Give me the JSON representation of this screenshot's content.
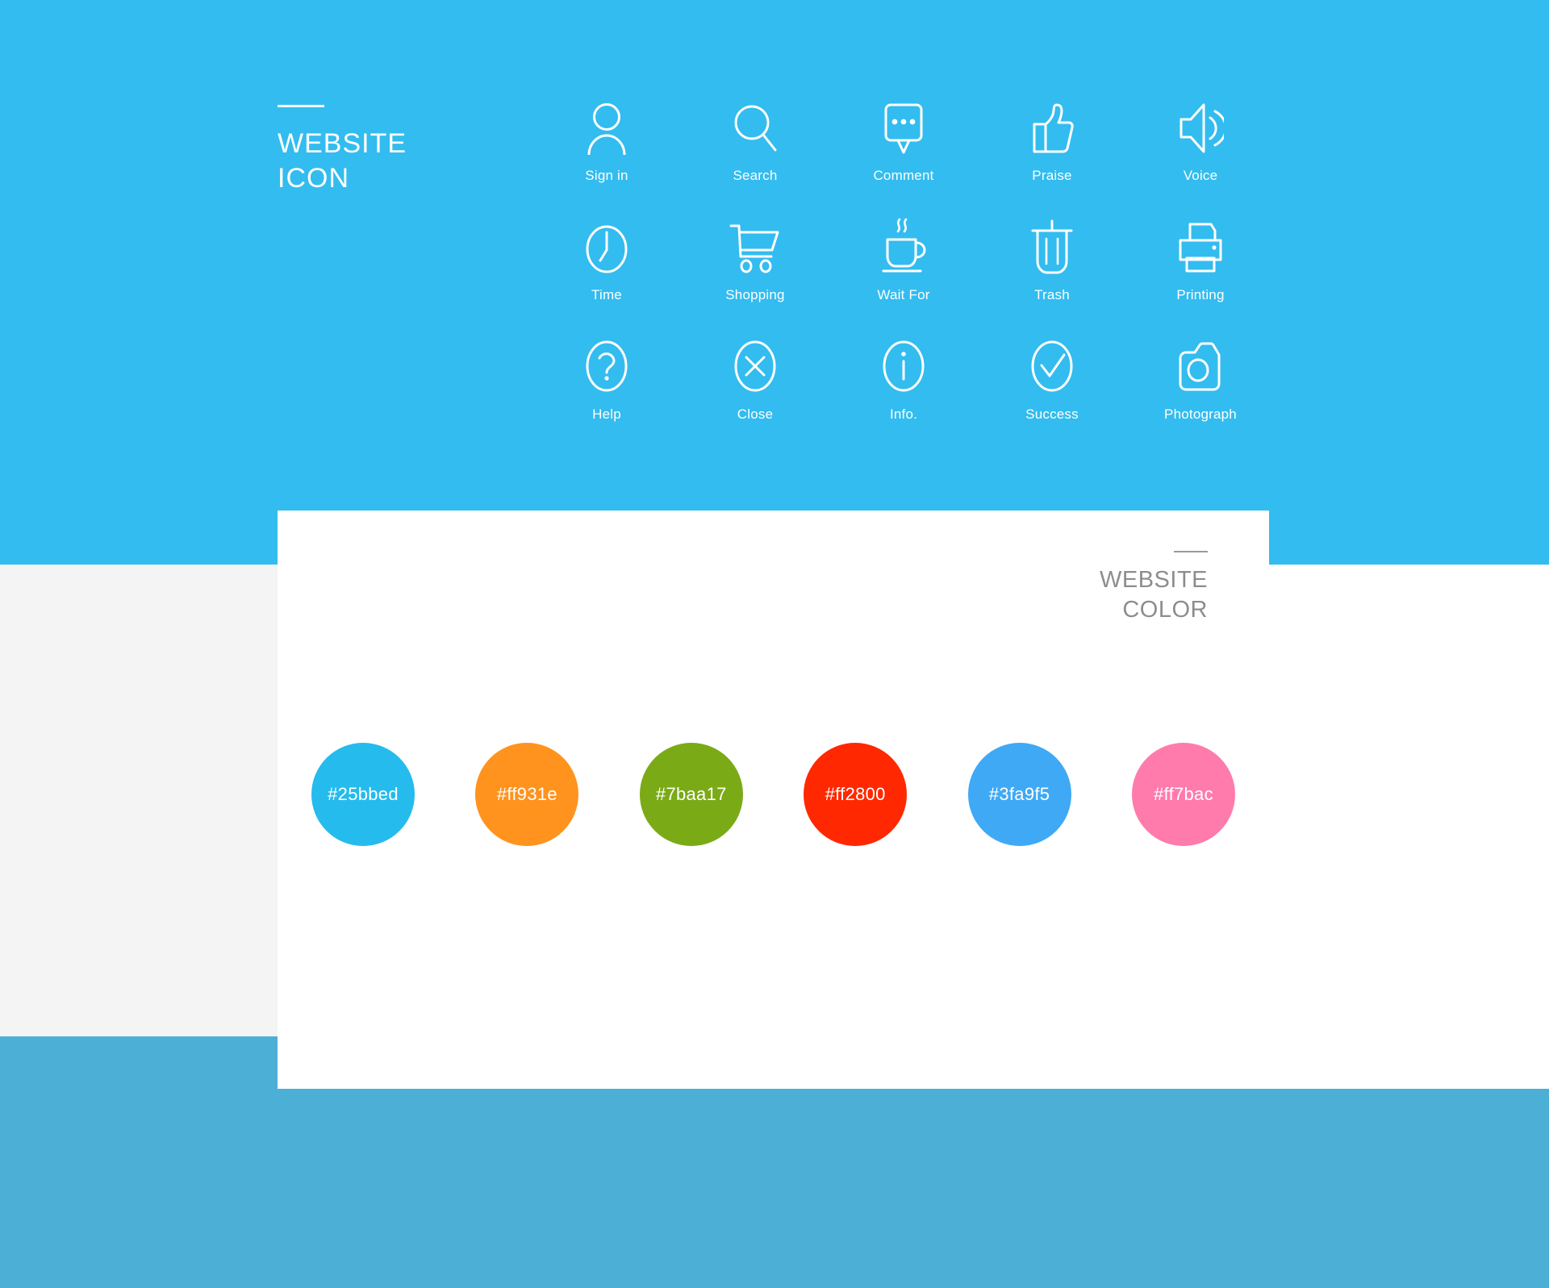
{
  "page": {
    "background_colors": {
      "header_blue": "#33bcef",
      "gray_band": "#f4f4f4",
      "footer_blue": "#4cb0d6",
      "card_white": "#ffffff"
    }
  },
  "header": {
    "title_line_1": "WEBSITE",
    "title_line_2": "ICON",
    "text_color": "#ffffff"
  },
  "icons": {
    "rows": [
      [
        {
          "label": "Sign in",
          "icon": "person-icon"
        },
        {
          "label": "Search",
          "icon": "magnifier-icon"
        },
        {
          "label": "Comment",
          "icon": "speech-bubble-icon"
        },
        {
          "label": "Praise",
          "icon": "thumbs-up-icon"
        },
        {
          "label": "Voice",
          "icon": "speaker-icon"
        }
      ],
      [
        {
          "label": "Time",
          "icon": "clock-icon"
        },
        {
          "label": "Shopping",
          "icon": "shopping-cart-icon"
        },
        {
          "label": "Wait For",
          "icon": "coffee-cup-icon"
        },
        {
          "label": "Trash",
          "icon": "trash-bin-icon"
        },
        {
          "label": "Printing",
          "icon": "printer-icon"
        }
      ],
      [
        {
          "label": "Help",
          "icon": "question-mark-circle-icon"
        },
        {
          "label": "Close",
          "icon": "x-circle-icon"
        },
        {
          "label": "Info.",
          "icon": "info-circle-icon"
        },
        {
          "label": "Success",
          "icon": "check-circle-icon"
        },
        {
          "label": "Photograph",
          "icon": "camera-icon"
        }
      ]
    ]
  },
  "color_card": {
    "title_line_1": "WEBSITE",
    "title_line_2": "COLOR",
    "title_color": "#8d8d8d",
    "swatches": [
      {
        "hex": "#25bbed",
        "label": "#25bbed"
      },
      {
        "hex": "#ff931e",
        "label": "#ff931e"
      },
      {
        "hex": "#7baa17",
        "label": "#7baa17"
      },
      {
        "hex": "#ff2800",
        "label": "#ff2800"
      },
      {
        "hex": "#3fa9f5",
        "label": "#3fa9f5"
      },
      {
        "hex": "#ff7bac",
        "label": "#ff7bac"
      }
    ]
  }
}
